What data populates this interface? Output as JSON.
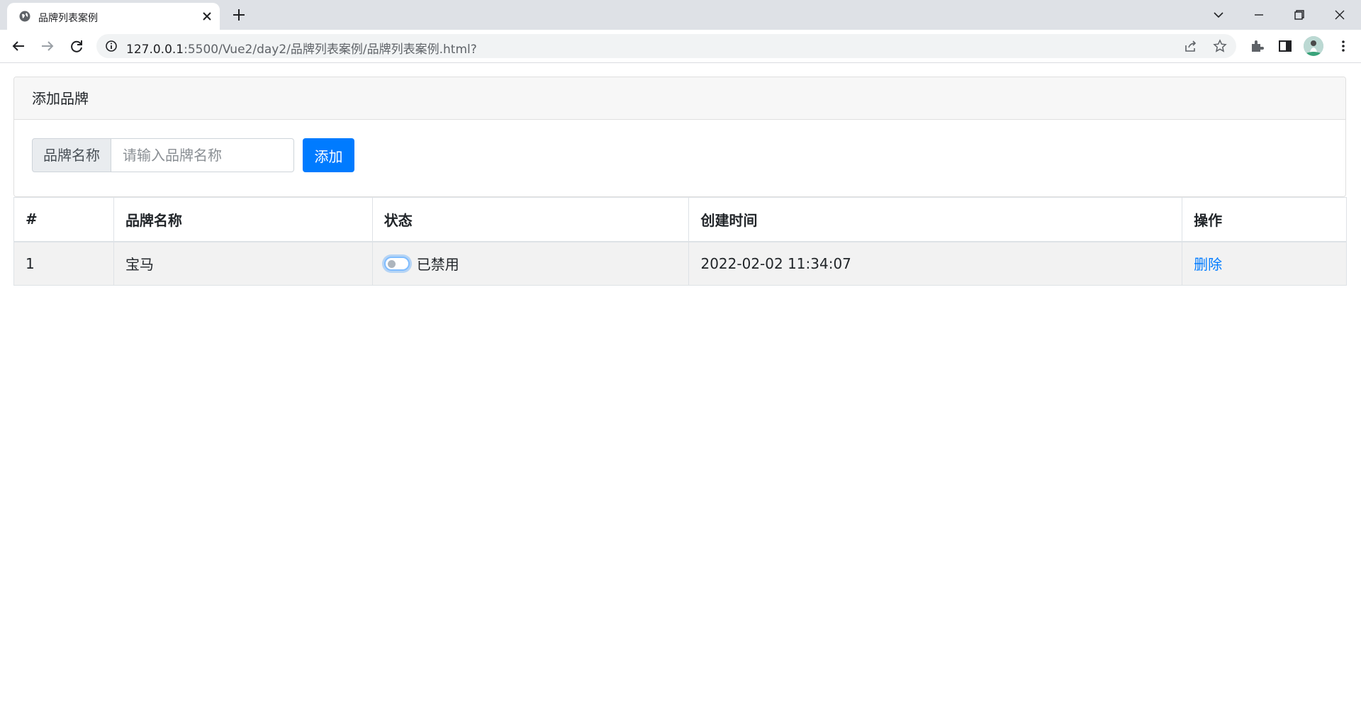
{
  "browser": {
    "tab_title": "品牌列表案例",
    "url_host": "127.0.0.1",
    "url_rest": ":5500/Vue2/day2/品牌列表案例/品牌列表案例.html?"
  },
  "card": {
    "header": "添加品牌",
    "input_label": "品牌名称",
    "input_placeholder": "请输入品牌名称",
    "input_value": "",
    "add_button": "添加"
  },
  "table": {
    "headers": [
      "#",
      "品牌名称",
      "状态",
      "创建时间",
      "操作"
    ],
    "rows": [
      {
        "id": "1",
        "name": "宝马",
        "status_checked": false,
        "status_text": "已禁用",
        "created": "2022-02-02 11:34:07",
        "action": "删除"
      }
    ]
  },
  "colors": {
    "primary": "#007bff",
    "header_bg": "#f7f7f7",
    "row_stripe": "#f2f2f2"
  }
}
